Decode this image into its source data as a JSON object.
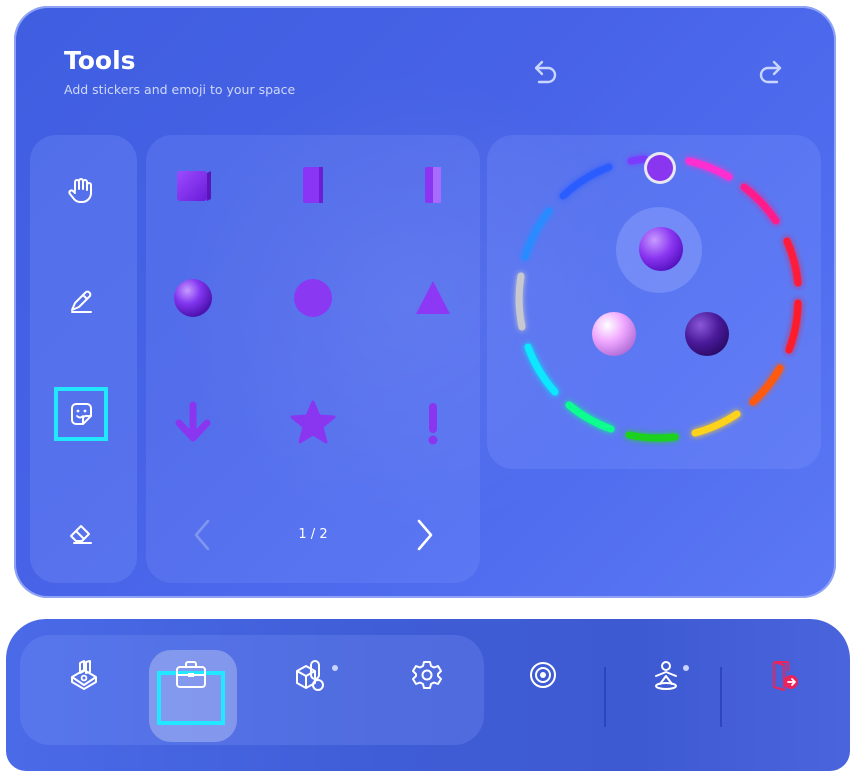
{
  "panel": {
    "title": "Tools",
    "subtitle": "Add stickers and emoji to your space"
  },
  "toolbar": {
    "tools": [
      "hand-icon",
      "pen-icon",
      "sticker-icon",
      "eraser-icon"
    ],
    "selected_tool": "sticker-icon"
  },
  "stickers": {
    "items": [
      "cube-shape",
      "tall-block-shape",
      "slab-shape",
      "sphere-shape",
      "circle-shape",
      "triangle-shape",
      "arrow-down-shape",
      "star-shape",
      "exclamation-shape"
    ],
    "page": "1 / 2",
    "color": "#8a3cf0"
  },
  "color_picker": {
    "swatches": [
      "#8a35f0",
      "#f0a8ff",
      "#4a1a9a"
    ],
    "ring_colors": [
      "#ff2fd0",
      "#ff1f8a",
      "#ff1a3a",
      "#ff5a10",
      "#ffd21a",
      "#1fd21f",
      "#10ff90",
      "#10e8ff",
      "#2a8aff",
      "#c8c8d0"
    ],
    "selected_handle": "#8a35f0"
  },
  "taskbar": {
    "items": [
      "model-icon",
      "toolbox-icon",
      "shapes-icon",
      "settings-icon",
      "target-icon",
      "avatar-icon",
      "exit-icon"
    ],
    "active": "toolbox-icon",
    "exit_color": "#e8245a"
  }
}
